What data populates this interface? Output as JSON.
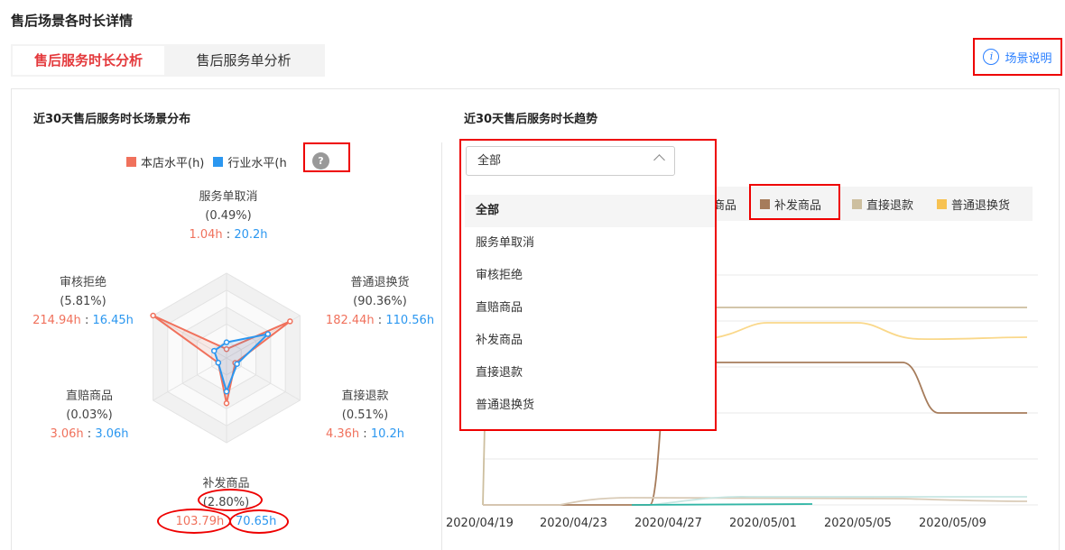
{
  "page": {
    "title": "售后场景各时长详情"
  },
  "tabs": [
    {
      "label": "售后服务时长分析",
      "active": true
    },
    {
      "label": "售后服务单分析",
      "active": false
    }
  ],
  "help_link": {
    "label": "场景说明",
    "icon": "info-icon"
  },
  "distribution": {
    "title": "近30天售后服务时长场景分布",
    "legend": [
      {
        "label": "本店水平(h)",
        "color": "#f0715c"
      },
      {
        "label": "行业水平(h",
        "color": "#2b97f0"
      }
    ],
    "help_icon": "?",
    "separator": ":",
    "axes": [
      {
        "name": "服务单取消",
        "pct": "(0.49%)",
        "store": "1.04h",
        "industry": "20.2h"
      },
      {
        "name": "普通退换货",
        "pct": "(90.36%)",
        "store": "182.44h",
        "industry": "110.56h"
      },
      {
        "name": "直接退款",
        "pct": "(0.51%)",
        "store": "4.36h",
        "industry": "10.2h"
      },
      {
        "name": "补发商品",
        "pct": "(2.80%)",
        "store": "103.79h",
        "industry": "70.65h"
      },
      {
        "name": "直赔商品",
        "pct": "(0.03%)",
        "store": "3.06h",
        "industry": "3.06h"
      },
      {
        "name": "审核拒绝",
        "pct": "(5.81%)",
        "store": "214.94h",
        "industry": "16.45h"
      }
    ]
  },
  "chart_data": {
    "type": "radar",
    "axes": [
      "服务单取消",
      "普通退换货",
      "直接退款",
      "补发商品",
      "直赔商品",
      "审核拒绝"
    ],
    "series": [
      {
        "name": "本店水平(h)",
        "values": [
          1.04,
          182.44,
          4.36,
          103.79,
          3.06,
          214.94
        ],
        "color": "#f0715c"
      },
      {
        "name": "行业水平(h",
        "values": [
          20.2,
          110.56,
          10.2,
          70.65,
          3.06,
          16.45
        ],
        "color": "#2b97f0"
      }
    ]
  },
  "trend": {
    "title": "近30天售后服务时长趋势",
    "select_value": "全部",
    "options": [
      "全部",
      "服务单取消",
      "审核拒绝",
      "直赔商品",
      "补发商品",
      "直接退款",
      "普通退换货"
    ],
    "legend": [
      {
        "label": "商品",
        "color": ""
      },
      {
        "label": "补发商品",
        "color": "#a67c5b"
      },
      {
        "label": "直接退款",
        "color": "#cdbf9f"
      },
      {
        "label": "普通退换货",
        "color": "#f7c252"
      }
    ],
    "x_ticks": [
      "2020/04/19",
      "2020/04/23",
      "2020/04/27",
      "2020/05/01",
      "2020/05/05",
      "2020/05/09"
    ]
  }
}
